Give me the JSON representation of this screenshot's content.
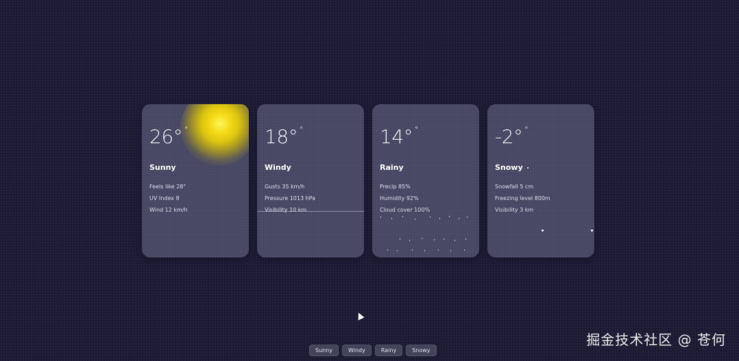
{
  "cards": [
    {
      "temp": "26°",
      "unit": "°",
      "condition": "Sunny",
      "details": [
        "Feels like 28°",
        "UV Index 8",
        "Wind 12 km/h"
      ]
    },
    {
      "temp": "18°",
      "unit": "°",
      "condition": "Windy",
      "details": [
        "Gusts 35 km/h",
        "Pressure 1013 hPa",
        "Visibility 10 km"
      ]
    },
    {
      "temp": "14°",
      "unit": "°",
      "condition": "Rainy",
      "details": [
        "Precip 85%",
        "Humidity 92%",
        "Cloud cover 100%"
      ]
    },
    {
      "temp": "-2°",
      "unit": "°",
      "condition": "Snowy",
      "details": [
        "Snowfall 5 cm",
        "Freezing level 800m",
        "Visibility 3 km"
      ]
    }
  ],
  "controls": [
    "Sunny",
    "Windy",
    "Rainy",
    "Snowy"
  ],
  "watermark": "掘金技术社区 @ 苍何",
  "colors": {
    "background": "#1c1a33",
    "card": "#6e6e8c",
    "sun": "#f3d915"
  }
}
